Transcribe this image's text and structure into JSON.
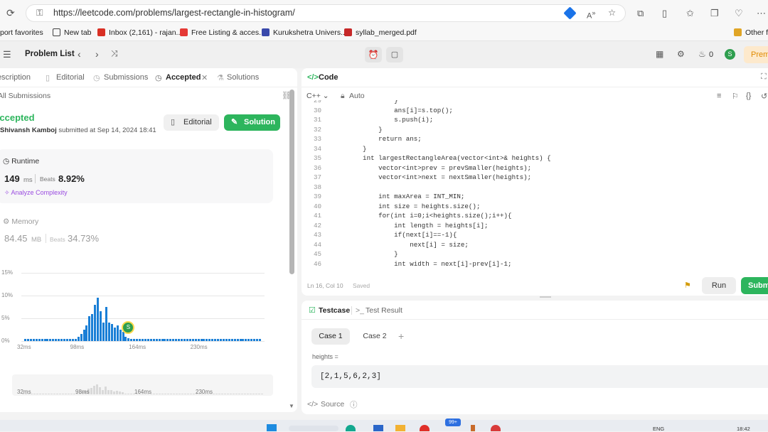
{
  "browser": {
    "url": "https://leetcode.com/problems/largest-rectangle-in-histogram/",
    "bookmarks": [
      {
        "label": "port favorites",
        "icon": "",
        "color": "#777777"
      },
      {
        "label": "New tab",
        "icon": "newtab-icon",
        "color": "#444444"
      },
      {
        "label": "Inbox (2,161) - rajan...",
        "icon": "gmail-icon",
        "color": "#d93025"
      },
      {
        "label": "Free Listing & acces...",
        "icon": "listing-icon",
        "color": "#e53935"
      },
      {
        "label": "Kurukshetra Univers...",
        "icon": "university-icon",
        "color": "#3949ab"
      },
      {
        "label": "syllab_merged.pdf",
        "icon": "pdf-icon",
        "color": "#c62828"
      },
      {
        "label": "Other fa",
        "icon": "folder-icon",
        "color": "#e0a526"
      }
    ]
  },
  "lc_top": {
    "problem_list": "Problem List",
    "streak": "0",
    "avatar": "S",
    "premium": "Prem"
  },
  "left": {
    "tabs": [
      {
        "label": "Description"
      },
      {
        "label": "Editorial"
      },
      {
        "label": "Submissions"
      },
      {
        "label": "Accepted"
      },
      {
        "label": "Solutions"
      }
    ],
    "all_submissions": "All Submissions",
    "status": "Accepted",
    "user": "Shivansh Kamboj",
    "submitted_text": "submitted at Sep 14, 2024 18:41",
    "editorial_btn": "Editorial",
    "solution_btn": "Solution",
    "runtime": {
      "title": "Runtime",
      "value": "149",
      "unit": "ms",
      "beats_label": "Beats",
      "beats": "8.92%",
      "analyze": "Analyze Complexity"
    },
    "memory": {
      "title": "Memory",
      "value": "84.45",
      "unit": "MB",
      "beats_label": "Beats",
      "beats": "34.73%"
    }
  },
  "chart_data": {
    "type": "bar",
    "yticks": [
      "15%",
      "10%",
      "5%",
      "0%"
    ],
    "xticks": [
      "32ms",
      "98ms",
      "164ms",
      "230ms"
    ],
    "ylim": [
      0,
      15
    ],
    "marker_label": "S",
    "values": [
      0.5,
      0.5,
      0.5,
      0.5,
      0.5,
      0.5,
      0.5,
      0.5,
      0.5,
      0.5,
      0.5,
      0.5,
      0.5,
      0.5,
      0.5,
      0.5,
      0.5,
      0.5,
      0.5,
      1.0,
      1.5,
      2.5,
      3.5,
      5.5,
      6.0,
      8.0,
      9.5,
      6.5,
      4.0,
      7.5,
      4.0,
      3.8,
      3.0,
      3.5,
      2.5,
      2.0,
      1.0,
      0.6,
      0.5,
      0.5,
      0.5,
      0.5,
      0.5,
      0.5,
      0.5,
      0.5,
      0.5,
      0.5,
      0.5,
      0.5,
      0.5,
      0.5,
      0.5,
      0.5,
      0.5,
      0.5,
      0.5,
      0.5,
      0.5,
      0.5,
      0.5,
      0.5,
      0.5,
      0.5,
      0.5,
      0.5,
      0.5,
      0.5,
      0.5,
      0.5,
      0.5,
      0.5,
      0.5,
      0.5,
      0.5,
      0.5,
      0.5,
      0.5,
      0.5,
      0.5,
      0.5,
      0.5,
      0.5,
      0.5,
      0.5
    ]
  },
  "mini_chart": {
    "xticks": [
      "32ms",
      "98ms",
      "164ms",
      "230ms"
    ]
  },
  "code": {
    "header": "Code",
    "language": "C++",
    "mode": "Auto",
    "status": "Ln 16, Col 10",
    "saved": "Saved",
    "run": "Run",
    "submit": "Subm",
    "lines": [
      {
        "n": "29",
        "t": "            }"
      },
      {
        "n": "30",
        "t": "            ans[i]=s.top();"
      },
      {
        "n": "31",
        "t": "            s.push(i);"
      },
      {
        "n": "32",
        "t": "        }"
      },
      {
        "n": "33",
        "t": "        return ans;"
      },
      {
        "n": "34",
        "t": "    }"
      },
      {
        "n": "35",
        "t": "    int largestRectangleArea(vector<int>& heights) {"
      },
      {
        "n": "36",
        "t": "        vector<int>prev = prevSmaller(heights);"
      },
      {
        "n": "37",
        "t": "        vector<int>next = nextSmaller(heights);"
      },
      {
        "n": "38",
        "t": ""
      },
      {
        "n": "39",
        "t": "        int maxArea = INT_MIN;"
      },
      {
        "n": "40",
        "t": "        int size = heights.size();"
      },
      {
        "n": "41",
        "t": "        for(int i=0;i<heights.size();i++){"
      },
      {
        "n": "42",
        "t": "            int length = heights[i];"
      },
      {
        "n": "43",
        "t": "            if(next[i]==-1){"
      },
      {
        "n": "44",
        "t": "                next[i] = size;"
      },
      {
        "n": "45",
        "t": "            }"
      },
      {
        "n": "46",
        "t": "            int width = next[i]-prev[i]-1;"
      }
    ]
  },
  "testcase": {
    "tab": "Testcase",
    "result_tab": "Test Result",
    "cases": [
      "Case 1",
      "Case 2"
    ],
    "add": "+",
    "param_label": "heights =",
    "param_value": "[2,1,5,6,2,3]",
    "source": "Source"
  },
  "taskbar": {
    "lang": "ENG",
    "time": "18:42",
    "badge": "99+"
  }
}
